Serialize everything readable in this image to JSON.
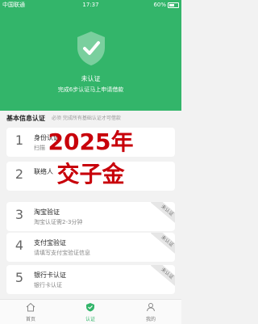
{
  "status_bar": {
    "carrier": "中国联通",
    "time": "17:37",
    "battery": "60%"
  },
  "header": {
    "status_title": "未认证",
    "status_sub": "完成6步认证马上申请借款"
  },
  "section": {
    "title": "基本信息认证",
    "hint": "必须 完成所有基础认证才可借款"
  },
  "cards": [
    {
      "num": "1",
      "name": "身份认证",
      "desc": "扫描",
      "badge": ""
    },
    {
      "num": "2",
      "name": "联络人",
      "desc": "",
      "badge": ""
    },
    {
      "num": "3",
      "name": "淘宝验证",
      "desc": "淘宝认证需2-3分钟",
      "badge": "未认证"
    },
    {
      "num": "4",
      "name": "支付宝验证",
      "desc": "请填写支付宝验证信息",
      "badge": "未认证"
    },
    {
      "num": "5",
      "name": "银行卡认证",
      "desc": "银行卡认证",
      "badge": "未认证"
    }
  ],
  "overlay": {
    "line1": "2025年",
    "line2": "交子金"
  },
  "tabbar": {
    "home": "首页",
    "verify": "认证",
    "mine": "我的"
  },
  "colors": {
    "brand": "#33b56a",
    "overlay": "#c8000a"
  }
}
